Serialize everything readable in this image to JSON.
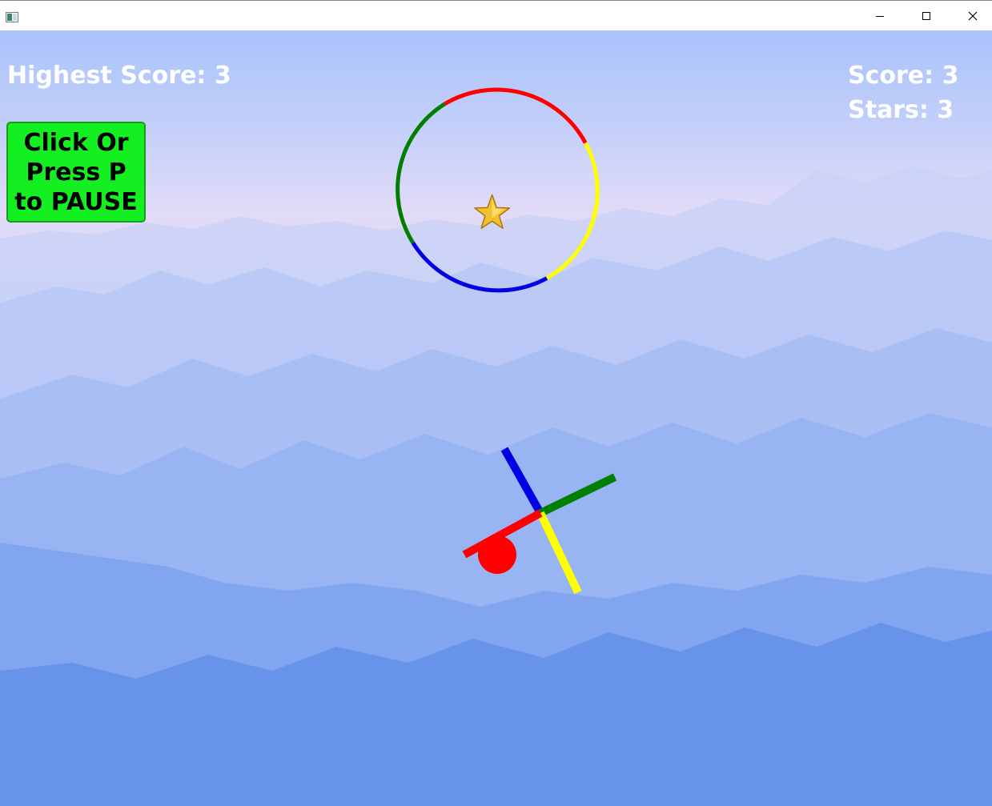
{
  "window": {
    "title": "",
    "icon": "app-window-icon",
    "controls": [
      "minimize-icon",
      "maximize-icon",
      "close-icon"
    ]
  },
  "hud": {
    "highest_score_text": "Highest Score: 3",
    "score_text": "Score: 3",
    "stars_text": "Stars: 3"
  },
  "pause_button": {
    "label": "Click Or\nPress P\nto PAUSE",
    "color": "#14ef21"
  },
  "colors": {
    "red": "#ff0000",
    "yellow": "#ffff00",
    "blue": "#0000e6",
    "green": "#007f00",
    "star": "#f2c12e",
    "sky_top": "#b9cdfb",
    "haze": "#e6dcf7",
    "mountains": "#5f8fe8"
  },
  "obstacles": [
    {
      "type": "ring",
      "segment_colors": [
        "red",
        "yellow",
        "blue",
        "green"
      ]
    },
    {
      "type": "cross",
      "arm_colors": [
        "blue",
        "green",
        "yellow",
        "red"
      ]
    }
  ],
  "player_ball": {
    "color": "red"
  },
  "star_pickup": {
    "icon": "star-icon"
  }
}
